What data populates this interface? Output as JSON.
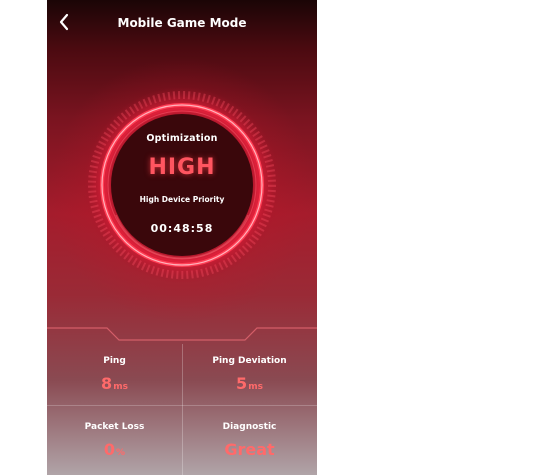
{
  "header": {
    "title": "Mobile Game Mode"
  },
  "gauge": {
    "label": "Optimization",
    "level": "HIGH",
    "subtitle": "High Device Priority",
    "timer": "00:48:58"
  },
  "stats": {
    "ping": {
      "label": "Ping",
      "value": "8",
      "unit": "ms"
    },
    "ping_deviation": {
      "label": "Ping Deviation",
      "value": "5",
      "unit": "ms"
    },
    "packet_loss": {
      "label": "Packet Loss",
      "value": "0",
      "unit": "%"
    },
    "diagnostic": {
      "label": "Diagnostic",
      "value": "Great"
    }
  },
  "colors": {
    "accent": "#ff5560",
    "stat_value": "#ff6a6a"
  },
  "icons": {
    "back": "chevron-left-icon"
  }
}
